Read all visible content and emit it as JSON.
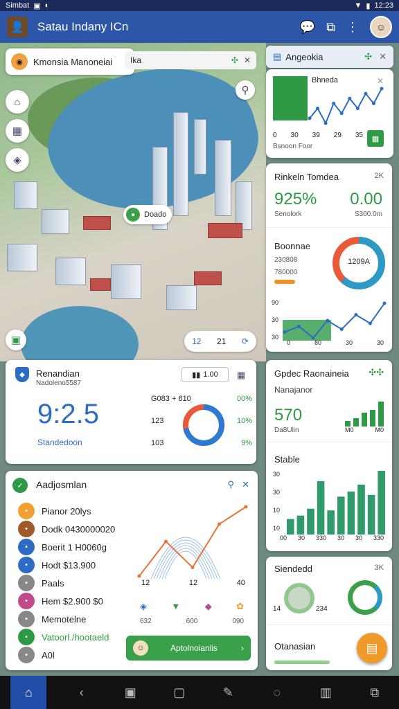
{
  "status": {
    "left_text": "Simbat",
    "time": "12:23"
  },
  "appbar": {
    "title": "Satau Indany ICn"
  },
  "map": {
    "location_chip": "Kmonsia Manoneiai",
    "search_text": "Ika",
    "pin_label": "Doado",
    "control_left": "12",
    "control_right": "21"
  },
  "card_top_right": {
    "title": "Angeokia",
    "chart_label": "Bhneda",
    "ticks": [
      "0",
      "30",
      "39",
      "29",
      "35"
    ],
    "footer": "Bsnoon Foor",
    "colors": {
      "green": "#2e9a45",
      "blue": "#2c6cc4"
    },
    "values": [
      3,
      5,
      2,
      6,
      4,
      7,
      5,
      8,
      6,
      9
    ]
  },
  "card_finance": {
    "title": "Rinkeln Tomdea",
    "badge": "2K",
    "left_value": "925%",
    "left_label": "Senolork",
    "right_value": "0.00",
    "right_label": "S300.0m",
    "section": "Boonnae",
    "stat_a": "230808",
    "stat_b": "780000",
    "donut_label": "1209A",
    "donut_value": 0.62,
    "axis_left": [
      "90",
      "30",
      "30"
    ],
    "axis_bottom": [
      "0",
      "80",
      "30",
      "30"
    ],
    "line_values": [
      12,
      14,
      10,
      16,
      13,
      18,
      15,
      22
    ]
  },
  "card_metric": {
    "title": "Renandian",
    "subtitle": "Nadoleno5587",
    "big_value": "9:2.5",
    "caption": "Standedoon",
    "chip": "1.00",
    "rows": [
      {
        "label": "G083 + 610",
        "value": "00%"
      },
      {
        "label": "123",
        "value": "10%"
      },
      {
        "label": "103",
        "value": "9%"
      }
    ],
    "donut_value": 0.72
  },
  "card_bars": {
    "title": "Gpdec Raonaineia",
    "subtitle": "Nanajanor",
    "value": "570",
    "caption": "Da8Ulin",
    "mini_labels": [
      "M0",
      "M0"
    ],
    "mini_bars": [
      2,
      3,
      5,
      6,
      9
    ],
    "section": "Stable",
    "axis_left": [
      "30",
      "30",
      "10",
      "10"
    ],
    "axis_bottom": [
      "00",
      "30",
      "330",
      "30",
      "30",
      "330"
    ],
    "bars": [
      18,
      22,
      30,
      62,
      28,
      44,
      50,
      58,
      46,
      74
    ]
  },
  "card_adjustment": {
    "title": "Aadjosmlan",
    "items": [
      {
        "text": "Pianor 20lys",
        "color": "#f0a030"
      },
      {
        "text": "Dodk 0430000020",
        "color": "#a05a2a"
      },
      {
        "text": "Boerit 1 H0060g",
        "color": "#2c6cc4"
      },
      {
        "text": "Hodt $13.900",
        "color": "#2c6cc4"
      },
      {
        "text": "Paals",
        "color": "#888888"
      },
      {
        "text": "Hem $2.900 $0",
        "color": "#c04a8a"
      },
      {
        "text": "Memotelne",
        "color": "#888888"
      },
      {
        "text": "Vatoorl./hootaeld",
        "color": "#2e9a45"
      },
      {
        "text": "A0l",
        "color": "#888888"
      }
    ],
    "graph_labels": [
      "12",
      "12",
      "40"
    ],
    "bottom_labels": [
      "632",
      "600",
      "090"
    ],
    "action_label": "Aptolnoianlis"
  },
  "card_standard": {
    "title": "Siendedd",
    "badge": "3K",
    "left_label": "14",
    "right_label": "234",
    "footer": "Otanasian"
  }
}
